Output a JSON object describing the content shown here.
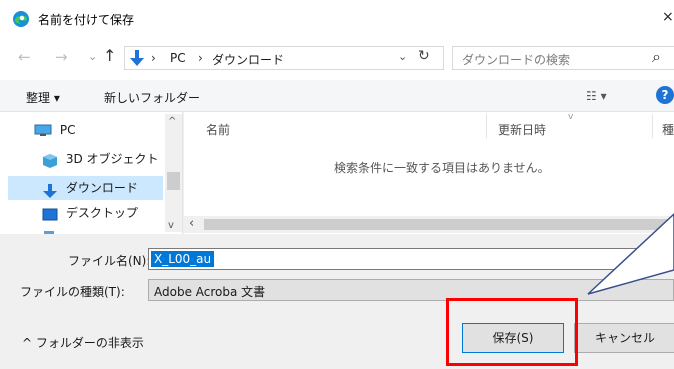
{
  "window": {
    "title": "名前を付けて保存",
    "close_glyph": "×"
  },
  "nav": {
    "back_glyph": "←",
    "forward_glyph": "→",
    "recent_glyph": "⌄",
    "up_glyph": "↑",
    "breadcrumb": [
      "PC",
      "ダウンロード"
    ],
    "separator": "›",
    "search_placeholder": "ダウンロードの検索",
    "refresh_glyph": "↻",
    "search_glyph": "⌕"
  },
  "toolbar": {
    "organize_label": "整理 ▾",
    "new_folder_label": "新しいフォルダー",
    "view_glyph": "☷ ▾",
    "help_glyph": "?"
  },
  "sidebar": {
    "items": [
      {
        "label": "PC"
      },
      {
        "label": "3D オブジェクト"
      },
      {
        "label": "ダウンロード"
      },
      {
        "label": "デスクトップ"
      }
    ]
  },
  "file_list": {
    "columns": [
      "名前",
      "更新日時",
      "種"
    ],
    "empty_message": "検索条件に一致する項目はありません。",
    "scroll_left_glyph": "‹"
  },
  "form": {
    "filename_label": "ファイル名(N):",
    "filename_value": "X_L00_au",
    "filetype_label": "ファイルの種類(T):",
    "filetype_value": "Adobe Acroba 文書"
  },
  "footer": {
    "hide_folders_label": "^ フォルダーの非表示",
    "save_label": "保存(S)",
    "cancel_label": "キャンセル"
  },
  "colors": {
    "selection": "#cce8ff",
    "accent": "#0078d7",
    "highlight_box": "#ff0000"
  }
}
